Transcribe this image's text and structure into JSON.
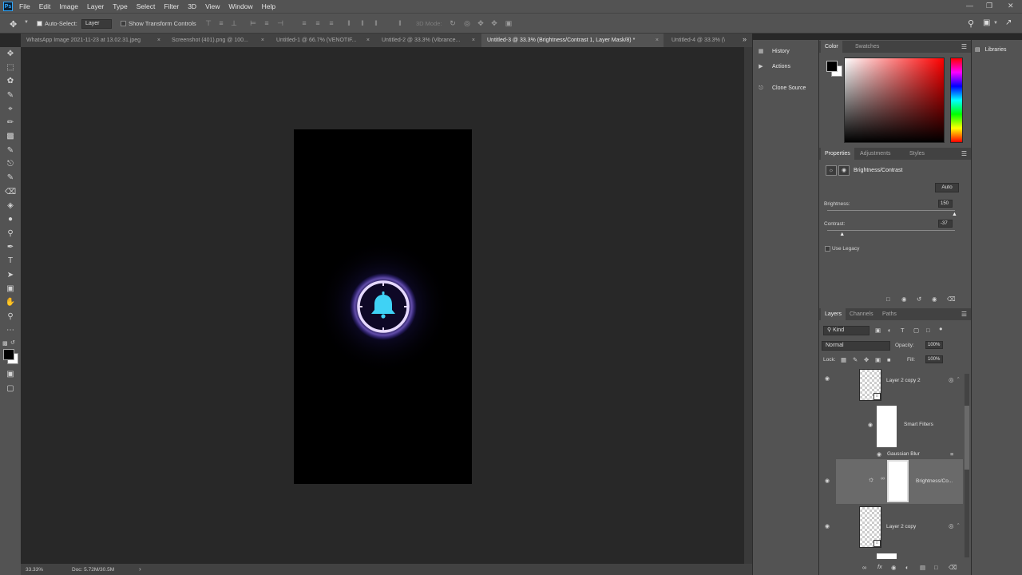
{
  "app": {
    "logo": "Ps"
  },
  "menu": [
    "File",
    "Edit",
    "Image",
    "Layer",
    "Type",
    "Select",
    "Filter",
    "3D",
    "View",
    "Window",
    "Help"
  ],
  "window_controls": [
    "minimize-icon",
    "restore-icon",
    "close-icon"
  ],
  "options": {
    "auto_select_label": "Auto-Select:",
    "auto_select_value": "Layer",
    "show_transform_label": "Show Transform Controls",
    "mode_3d_label": "3D Mode:"
  },
  "tabs": [
    {
      "label": "WhatsApp Image 2021-11-23 at 13.02.31.jpeg",
      "active": false
    },
    {
      "label": "Screenshot (401).png @ 100...",
      "active": false
    },
    {
      "label": "Untitled-1 @ 66.7% (VENOTIF...",
      "active": false
    },
    {
      "label": "Untitled-2 @ 33.3% (Vibrance...",
      "active": false
    },
    {
      "label": "Untitled-3 @ 33.3% (Brightness/Contrast 1, Layer Mask/8) *",
      "active": true
    },
    {
      "label": "Untitled-4 @ 33.3% (\\",
      "active": false
    }
  ],
  "status": {
    "zoom": "33.33%",
    "doc": "Doc: 5.72M/30.5M"
  },
  "collapsed_panels": [
    {
      "label": "History",
      "icon": "history-icon"
    },
    {
      "label": "Actions",
      "icon": "actions-icon"
    },
    {
      "label": "Clone Source",
      "icon": "clone-source-icon"
    }
  ],
  "color_panel": {
    "tabs": [
      "Color",
      "Swatches"
    ],
    "foreground": "#000000",
    "background": "#ffffff"
  },
  "properties": {
    "tabs": [
      "Properties",
      "Adjustments",
      "Styles"
    ],
    "title": "Brightness/Contrast",
    "auto_label": "Auto",
    "brightness_label": "Brightness:",
    "brightness_value": "150",
    "brightness_level": 1.0,
    "contrast_label": "Contrast:",
    "contrast_value": "-37",
    "contrast_level": 0.12,
    "use_legacy_label": "Use Legacy"
  },
  "layers_panel": {
    "tabs": [
      "Layers",
      "Channels",
      "Paths"
    ],
    "kind_label": "Kind",
    "blend_mode": "Normal",
    "opacity_label": "Opacity:",
    "opacity_value": "100%",
    "lock_label": "Lock:",
    "fill_label": "Fill:",
    "fill_value": "100%",
    "layers": [
      {
        "name": "Layer 2 copy 2"
      },
      {
        "name": "Smart Filters"
      },
      {
        "name": "Gaussian Blur"
      },
      {
        "name": "Brightness/Co..."
      },
      {
        "name": "Layer 2 copy"
      }
    ]
  },
  "libraries": {
    "label": "Libraries"
  },
  "accent": {
    "glow": "#6f5cff",
    "bell": "#3fd2f5",
    "ring": "#e6d9ff"
  }
}
